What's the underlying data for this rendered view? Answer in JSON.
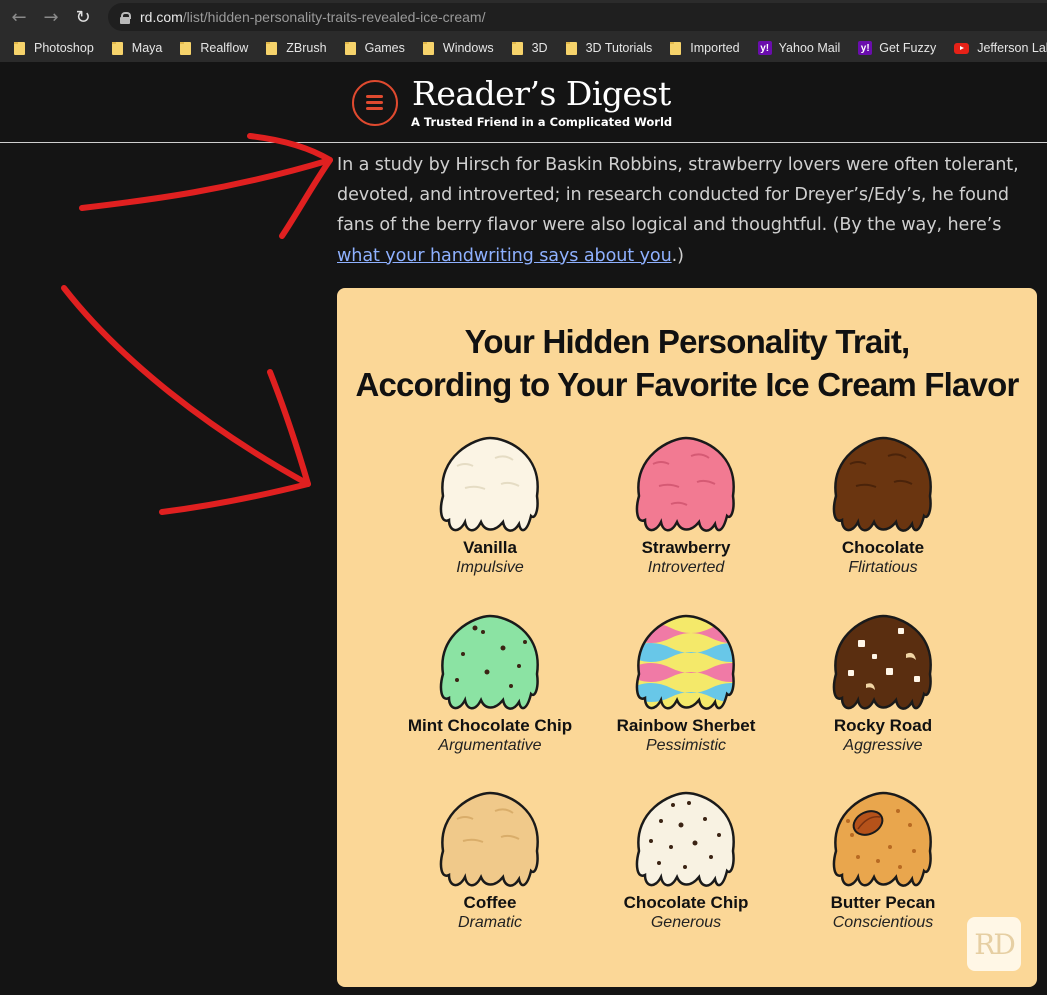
{
  "browser": {
    "url_host": "rd.com",
    "url_path": "/list/hidden-personality-traits-revealed-ice-cream/",
    "bookmarks": [
      {
        "label": "Photoshop",
        "icon": "folder-icon"
      },
      {
        "label": "Maya",
        "icon": "folder-icon"
      },
      {
        "label": "Realflow",
        "icon": "folder-icon"
      },
      {
        "label": "ZBrush",
        "icon": "folder-icon"
      },
      {
        "label": "Games",
        "icon": "folder-icon"
      },
      {
        "label": "Windows",
        "icon": "folder-icon"
      },
      {
        "label": "3D",
        "icon": "folder-icon"
      },
      {
        "label": "3D Tutorials",
        "icon": "folder-icon"
      },
      {
        "label": "Imported",
        "icon": "folder-icon"
      },
      {
        "label": "Yahoo Mail",
        "icon": "yahoo-icon"
      },
      {
        "label": "Get Fuzzy",
        "icon": "yahoo-icon"
      },
      {
        "label": "Jefferson Lab",
        "icon": "youtube-icon"
      }
    ]
  },
  "site": {
    "name": "Reader’s Digest",
    "tagline": "A Trusted Friend in a Complicated World",
    "accent_color": "#e04a2f"
  },
  "article": {
    "paragraph": "In a study by Hirsch for Baskin Robbins, strawberry lovers were often tolerant, devoted, and introverted; in research conducted for Dreyer’s/Edy’s, he found fans of the berry flavor were also logical and thoughtful. (By the way, here’s ",
    "link_text": "what your handwriting says about you",
    "paragraph_end": ".)"
  },
  "infographic": {
    "title_line1": "Your Hidden Personality Trait,",
    "title_line2": "According to Your Favorite Ice Cream Flavor",
    "background": "#fbd797",
    "badge": "RD",
    "flavors": [
      {
        "name": "Vanilla",
        "trait": "Impulsive",
        "color": "#fbf4e4"
      },
      {
        "name": "Strawberry",
        "trait": "Introverted",
        "color": "#f27a92"
      },
      {
        "name": "Chocolate",
        "trait": "Flirtatious",
        "color": "#6a3510"
      },
      {
        "name": "Mint Chocolate Chip",
        "trait": "Argumentative",
        "color": "#8be3a3"
      },
      {
        "name": "Rainbow Sherbet",
        "trait": "Pessimistic",
        "color": "#f4e96a"
      },
      {
        "name": "Rocky Road",
        "trait": "Aggressive",
        "color": "#5a2e10"
      },
      {
        "name": "Coffee",
        "trait": "Dramatic",
        "color": "#f0c98a"
      },
      {
        "name": "Chocolate Chip",
        "trait": "Generous",
        "color": "#f8f2e2"
      },
      {
        "name": "Butter Pecan",
        "trait": "Conscientious",
        "color": "#e9a64d"
      }
    ]
  },
  "annotation": {
    "arrow_color": "#e02020"
  }
}
